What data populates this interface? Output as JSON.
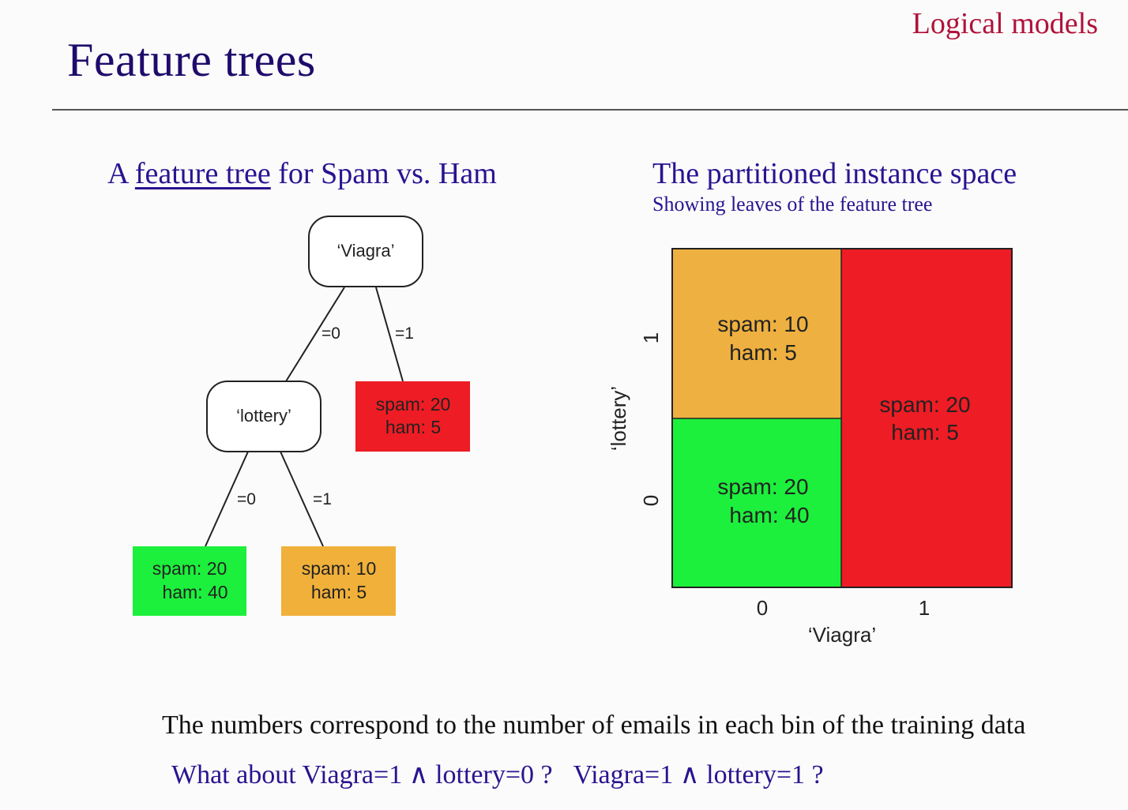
{
  "header": {
    "title": "Feature trees",
    "section": "Logical models"
  },
  "left": {
    "heading_prefix": "A ",
    "heading_link": "feature tree",
    "heading_suffix": " for Spam vs. Ham"
  },
  "right": {
    "heading": "The partitioned instance space",
    "subheading": "Showing leaves of the feature tree"
  },
  "tree": {
    "root": {
      "label": "‘Viagra’"
    },
    "root_edges": {
      "left": "=0",
      "right": "=1"
    },
    "inner": {
      "label": "‘lottery’"
    },
    "inner_edges": {
      "left": "=0",
      "right": "=1"
    },
    "leaf_viagra1": {
      "spam": "spam: 20",
      "ham": "ham: 5",
      "color": "#ee1c24"
    },
    "leaf_lottery0": {
      "spam": "spam: 20",
      "ham": "ham: 40",
      "color": "#1cf03c"
    },
    "leaf_lottery1": {
      "spam": "spam: 10",
      "ham": "ham: 5",
      "color": "#f0b03a"
    }
  },
  "grid": {
    "x_label": "‘Viagra’",
    "y_label": "‘lottery’",
    "x_ticks": [
      "0",
      "1"
    ],
    "y_ticks": [
      "0",
      "1"
    ],
    "cell_v0_l1": {
      "spam": "spam: 10",
      "ham": "ham: 5",
      "color": "#eeb040"
    },
    "cell_v0_l0": {
      "spam": "spam: 20",
      "ham": "ham: 40",
      "color": "#1cf03c"
    },
    "cell_v1": {
      "spam": "spam: 20",
      "ham": "ham: 5",
      "color": "#ee1c24"
    }
  },
  "footer": {
    "note": "The numbers correspond to the number of emails in each bin of the training data",
    "question_1": "What about Viagra=1 ∧ lottery=0 ?",
    "question_2": "Viagra=1 ∧ lottery=1 ?"
  }
}
